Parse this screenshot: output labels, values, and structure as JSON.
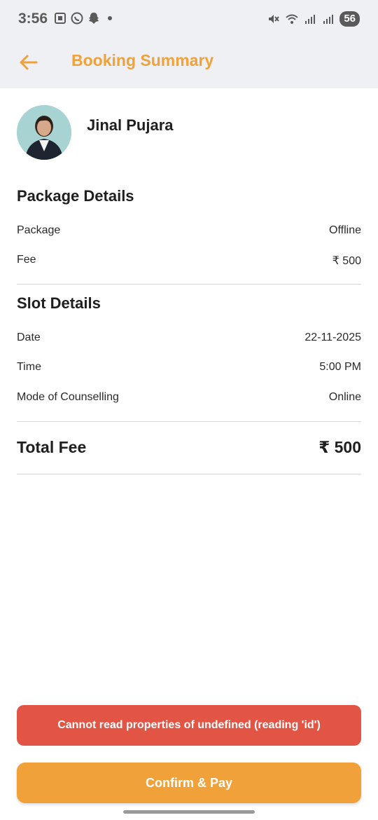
{
  "status_bar": {
    "time": "3:56",
    "battery": "56",
    "left_icons": [
      "screenshot-icon",
      "whatsapp-icon",
      "snapchat-icon",
      "notification-dot"
    ],
    "right_icons": [
      "mute-icon",
      "wifi-icon",
      "signal-icon",
      "signal-icon"
    ]
  },
  "app_bar": {
    "title": "Booking Summary",
    "back_icon": "arrow-left-icon",
    "accent_color": "#f0a13a"
  },
  "counsellor": {
    "name": "Jinal Pujara"
  },
  "package_details": {
    "title": "Package Details",
    "rows": [
      {
        "label": "Package",
        "value": "Offline"
      },
      {
        "label": "Fee",
        "value": "₹ 500"
      }
    ]
  },
  "slot_details": {
    "title": "Slot Details",
    "rows": [
      {
        "label": "Date",
        "value": "22-11-2025"
      },
      {
        "label": "Time",
        "value": "5:00 PM"
      },
      {
        "label": "Mode of Counselling",
        "value": "Online"
      }
    ]
  },
  "total": {
    "label": "Total Fee",
    "value": "₹ 500"
  },
  "error_message": "Cannot read properties of undefined (reading 'id')",
  "error_color": "#e25444",
  "confirm_button": {
    "label": "Confirm & Pay"
  }
}
